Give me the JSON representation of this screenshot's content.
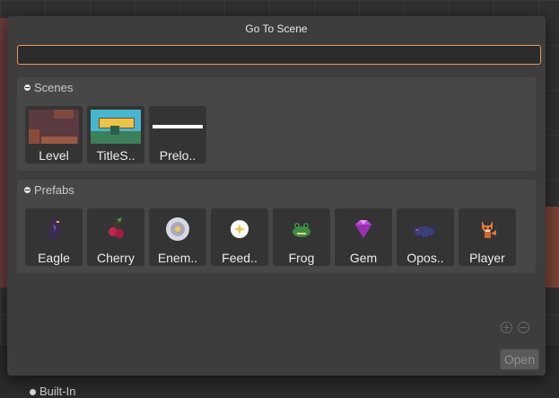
{
  "dialog": {
    "title": "Go To Scene",
    "search_value": "",
    "open_label": "Open"
  },
  "scenes": {
    "header": "Scenes",
    "items": [
      {
        "label": "Level",
        "icon": "level-thumbnail"
      },
      {
        "label": "TitleS..",
        "icon": "title-screen-thumbnail"
      },
      {
        "label": "Prelo..",
        "icon": "preloader-thumbnail"
      }
    ]
  },
  "prefabs": {
    "header": "Prefabs",
    "items": [
      {
        "label": "Eagle",
        "icon": "eagle-icon"
      },
      {
        "label": "Cherry",
        "icon": "cherry-icon"
      },
      {
        "label": "Enem..",
        "icon": "enemy-death-icon"
      },
      {
        "label": "Feed..",
        "icon": "feedback-icon"
      },
      {
        "label": "Frog",
        "icon": "frog-icon"
      },
      {
        "label": "Gem",
        "icon": "gem-icon"
      },
      {
        "label": "Opos..",
        "icon": "opossum-icon"
      },
      {
        "label": "Player",
        "icon": "player-icon"
      }
    ]
  },
  "background": {
    "built_in_label": "Built-In"
  },
  "colors": {
    "accent": "#e39b57",
    "dialog_bg": "#3d3d3d",
    "section_bg": "#474747"
  }
}
